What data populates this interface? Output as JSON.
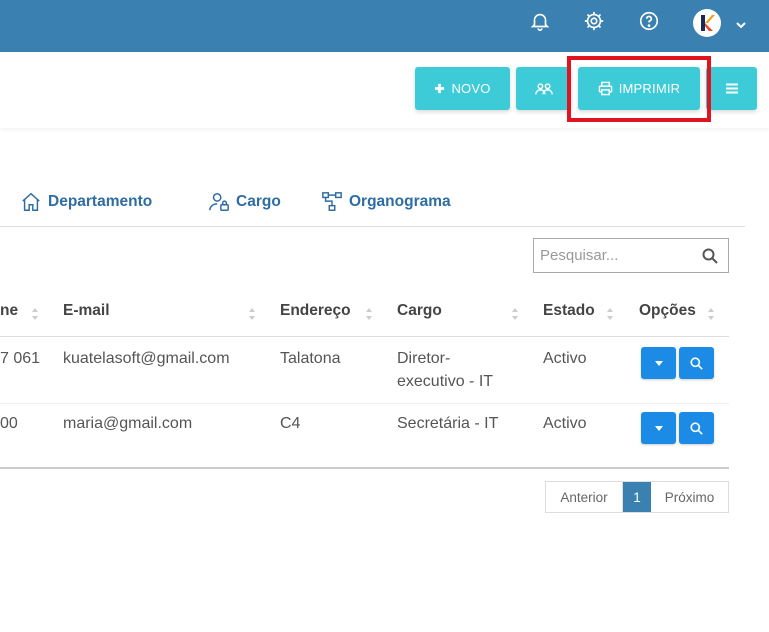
{
  "topbar": {
    "icons": [
      "bell-icon",
      "gear-icon",
      "help-icon",
      "avatar",
      "chevron-down-icon"
    ],
    "color": "#3a80b0"
  },
  "toolbar": {
    "new_label": "NOVO",
    "print_label": "IMPRIMIR",
    "button_color": "#3ecbd8",
    "highlight_color": "#e0141e"
  },
  "tabs": [
    {
      "label": "Departamento",
      "icon": "home-icon"
    },
    {
      "label": "Cargo",
      "icon": "user-lock-icon"
    },
    {
      "label": "Organograma",
      "icon": "sitemap-icon"
    }
  ],
  "search": {
    "placeholder": "Pesquisar..."
  },
  "table": {
    "columns": [
      "ne",
      "E-mail",
      "Endereço",
      "Cargo",
      "Estado",
      "Opções"
    ],
    "rows": [
      {
        "phone": "7 061",
        "email": "kuatelasoft@gmail.com",
        "address": "Talatona",
        "cargo_line1": "Diretor-",
        "cargo_line2": "executivo - IT",
        "estado": "Activo"
      },
      {
        "phone": "00",
        "email": "maria@gmail.com",
        "address": "C4",
        "cargo_line1": "Secretária - IT",
        "cargo_line2": "",
        "estado": "Activo"
      }
    ]
  },
  "pagination": {
    "prev": "Anterior",
    "current": "1",
    "next": "Próximo"
  },
  "accent": "#1c8be6"
}
